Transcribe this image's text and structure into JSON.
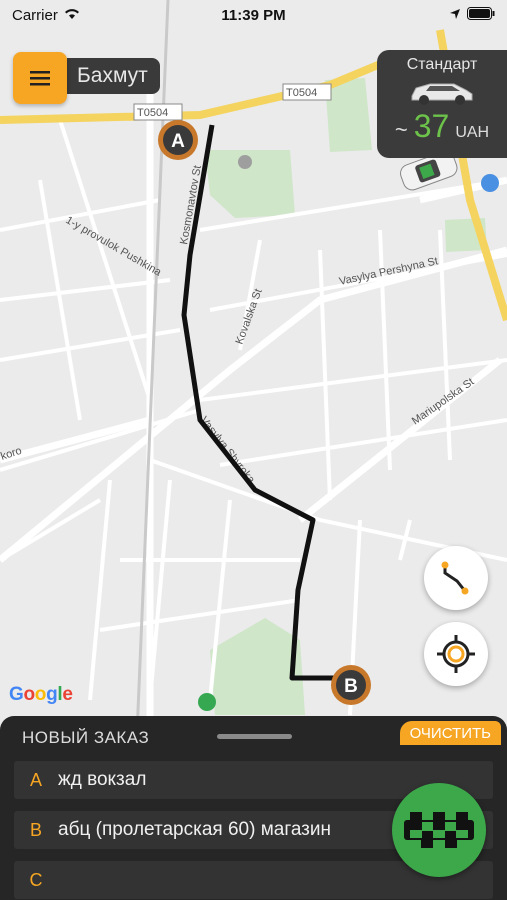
{
  "status_bar": {
    "carrier": "Carrier",
    "time": "11:39 PM"
  },
  "header": {
    "city": "Бахмут"
  },
  "tariff": {
    "name": "Стандарт",
    "approx": "~",
    "price": "37",
    "currency": "UAH"
  },
  "map": {
    "road_labels": {
      "t0504_a": "T0504",
      "t0504_b": "T0504",
      "kosmonavtov": "Kosmonavtov St",
      "pushkina": "1-y provulok Pushkina",
      "pershyna": "Vasylya Pershyna St",
      "kovalska": "Kovalska St",
      "shyroka": "Vasylya Shyroka",
      "mariupolska": "Mariupolska St",
      "koro": "koro"
    },
    "marker_a": "A",
    "marker_b": "B"
  },
  "google": {
    "g1": "G",
    "o1": "o",
    "o2": "o",
    "g2": "g",
    "l": "l",
    "e": "e"
  },
  "sheet": {
    "title": "НОВЫЙ ЗАКАЗ",
    "clear_label": "ОЧИСТИТЬ",
    "rows": [
      {
        "letter": "A",
        "text": "жд вокзал"
      },
      {
        "letter": "B",
        "text": "абц (пролетарская 60) магазин"
      },
      {
        "letter": "C",
        "text": ""
      }
    ]
  },
  "colors": {
    "accent": "#f6a623",
    "price": "#6cc24a",
    "taxi": "#3ca84a",
    "panel": "#262626"
  }
}
